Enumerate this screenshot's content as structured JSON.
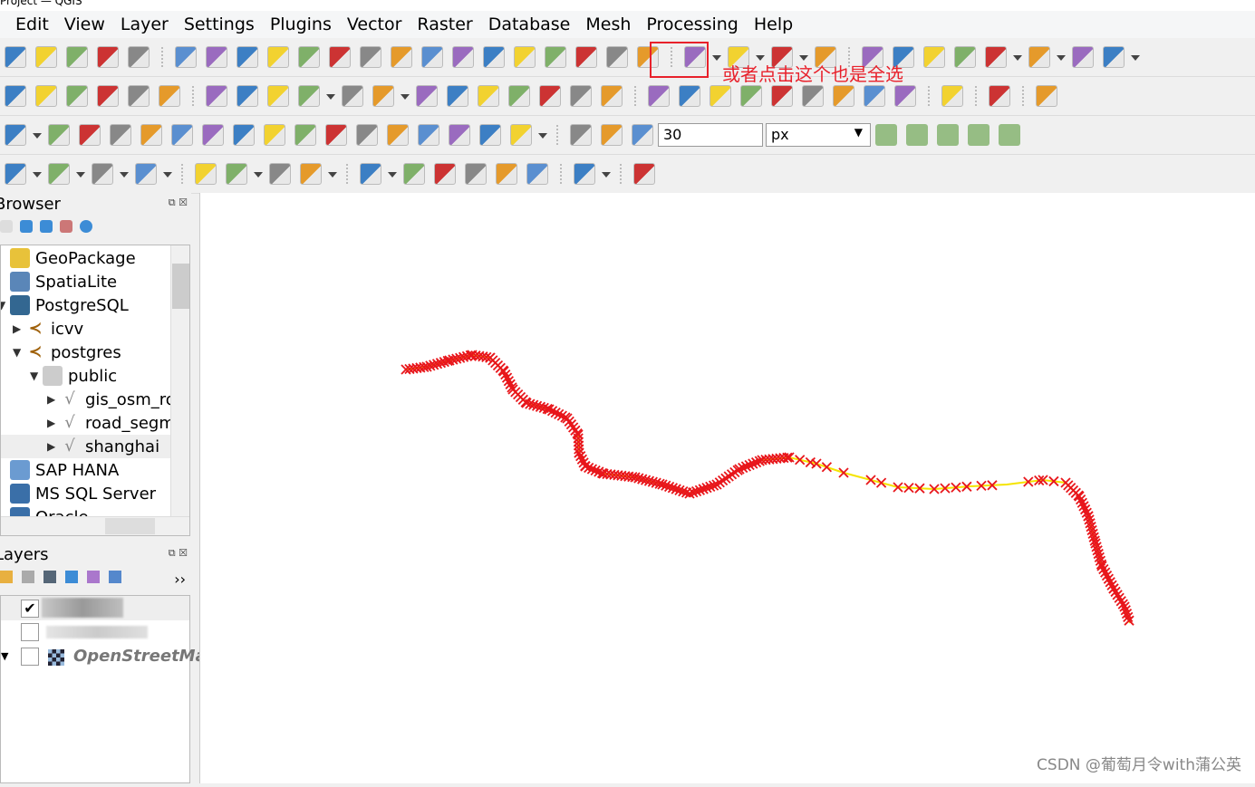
{
  "window": {
    "title": "Project — QGIS"
  },
  "menu": [
    "Edit",
    "View",
    "Layer",
    "Settings",
    "Plugins",
    "Vector",
    "Raster",
    "Database",
    "Mesh",
    "Processing",
    "Help"
  ],
  "toolbars": {
    "row1": [
      "open-project-icon",
      "save-project-icon",
      "new-print-layout-icon",
      "layout-manager-icon",
      "style-manager-icon",
      "|",
      "pan-icon",
      "pan-to-selection-icon",
      "zoom-in-icon",
      "zoom-out-icon",
      "zoom-full-icon",
      "zoom-to-selection-icon",
      "zoom-to-layer-icon",
      "zoom-native-icon",
      "zoom-last-icon",
      "zoom-next-icon",
      "new-map-view-icon",
      "new-3d-map-icon",
      "new-bookmark-icon",
      "show-bookmarks-icon",
      "temporal-controller-icon",
      "refresh-icon",
      "|",
      "select-features-icon",
      "dropdown",
      "deselect-icon",
      "dropdown",
      "select-by-value-icon",
      "dropdown",
      "select-by-location-icon",
      "|",
      "identify-icon",
      "attribute-table-icon",
      "toolbox-icon",
      "statistics-icon",
      "field-calculator-icon",
      "dropdown",
      "measure-icon",
      "dropdown",
      "map-tips-icon",
      "annotation-icon",
      "dropdown"
    ],
    "row2": [
      "new-layer-icon",
      "new-shapefile-icon",
      "new-spatialite-icon",
      "new-temp-layer-icon",
      "new-virtual-layer-icon",
      "new-mesh-icon",
      "|",
      "current-edits-icon",
      "toggle-editing-icon",
      "save-edits-icon",
      "digitize-line-icon",
      "dropdown",
      "vertex-tool-icon",
      "advanced-digitizing-icon",
      "dropdown",
      "modify-attributes-icon",
      "delete-selected-icon",
      "cut-features-icon",
      "copy-features-icon",
      "paste-features-icon",
      "undo-icon",
      "redo-icon",
      "|",
      "label-icon",
      "diagram-icon",
      "pin-label-icon",
      "label-highlight-icon",
      "move-label-icon",
      "show-label-icon",
      "rotate-label-icon",
      "change-label-icon",
      "edit-label-icon",
      "|",
      "db-manager-icon",
      "|",
      "python-console-icon",
      "|",
      "help-icon"
    ],
    "row3": [
      "reshape-icon",
      "dropdown",
      "rotate-feature-icon",
      "simplify-icon",
      "offset-curve-icon",
      "add-ring-icon",
      "add-part-icon",
      "fill-ring-icon",
      "delete-ring-icon",
      "delete-part-icon",
      "reshape-features-icon",
      "offset-icon",
      "reverse-line-icon",
      "split-features-icon",
      "split-parts-icon",
      "merge-features-icon",
      "merge-attributes-icon",
      "rotate-point-icon",
      "dropdown",
      "|",
      "snapping-icon",
      "snap-to-layer-icon",
      "snap-vertex-icon"
    ],
    "row4": [
      "circle-icon",
      "dropdown",
      "circle2-icon",
      "dropdown",
      "rectangle-icon",
      "dropdown",
      "polygon-icon",
      "dropdown",
      "|",
      "georef-icon",
      "select-georef-icon",
      "dropdown",
      "move-feature-icon",
      "mesh-edit-icon",
      "dropdown",
      "|",
      "label-text-icon",
      "dropdown",
      "select-move-annotation-icon",
      "add-polygon-annotation-icon",
      "add-line-annotation-icon",
      "add-marker-annotation-icon",
      "add-text-annotation-icon",
      "|",
      "text-annotation-icon",
      "dropdown",
      "|",
      "pointer-annotation-icon"
    ]
  },
  "snapping": {
    "tolerance": "30",
    "unit": "px"
  },
  "snap_extra": [
    "topology-icon",
    "avoid-overlap-icon",
    "intersection-icon",
    "self-snap-icon",
    "tracing-icon"
  ],
  "browser": {
    "title": "Browser",
    "items": [
      {
        "label": "GeoPackage",
        "icon": "geopackage-icon",
        "level": 0,
        "expander": ""
      },
      {
        "label": "SpatiaLite",
        "icon": "spatialite-icon",
        "level": 0,
        "expander": ""
      },
      {
        "label": "PostgreSQL",
        "icon": "postgresql-icon",
        "level": 0,
        "expander": "▼"
      },
      {
        "label": "icvv",
        "icon": "connection-icon",
        "level": 1,
        "expander": "▶"
      },
      {
        "label": "postgres",
        "icon": "connection-icon",
        "level": 1,
        "expander": "▼"
      },
      {
        "label": "public",
        "icon": "schema-icon",
        "level": 2,
        "expander": "▼"
      },
      {
        "label": "gis_osm_ro",
        "icon": "line-layer-icon",
        "level": 3,
        "expander": "▶"
      },
      {
        "label": "road_segm",
        "icon": "line-layer-icon",
        "level": 3,
        "expander": "▶"
      },
      {
        "label": "shanghai",
        "icon": "line-layer-icon",
        "level": 3,
        "expander": "▶"
      },
      {
        "label": "SAP HANA",
        "icon": "sap-hana-icon",
        "level": 0,
        "expander": ""
      },
      {
        "label": "MS SQL Server",
        "icon": "mssql-icon",
        "level": 0,
        "expander": ""
      },
      {
        "label": "Oracle",
        "icon": "oracle-icon",
        "level": 0,
        "expander": ""
      }
    ]
  },
  "layers": {
    "title": "Layers",
    "more": "››",
    "items": [
      {
        "label": "OpenStreetMap",
        "checked": false
      }
    ]
  },
  "annotation": {
    "text": "或者点击这个也是全选",
    "color": "#e8212b"
  },
  "watermark": "CSDN @葡萄月令with蒲公英",
  "colors": {
    "line": "#f5e400",
    "marker": "#e8161b"
  }
}
